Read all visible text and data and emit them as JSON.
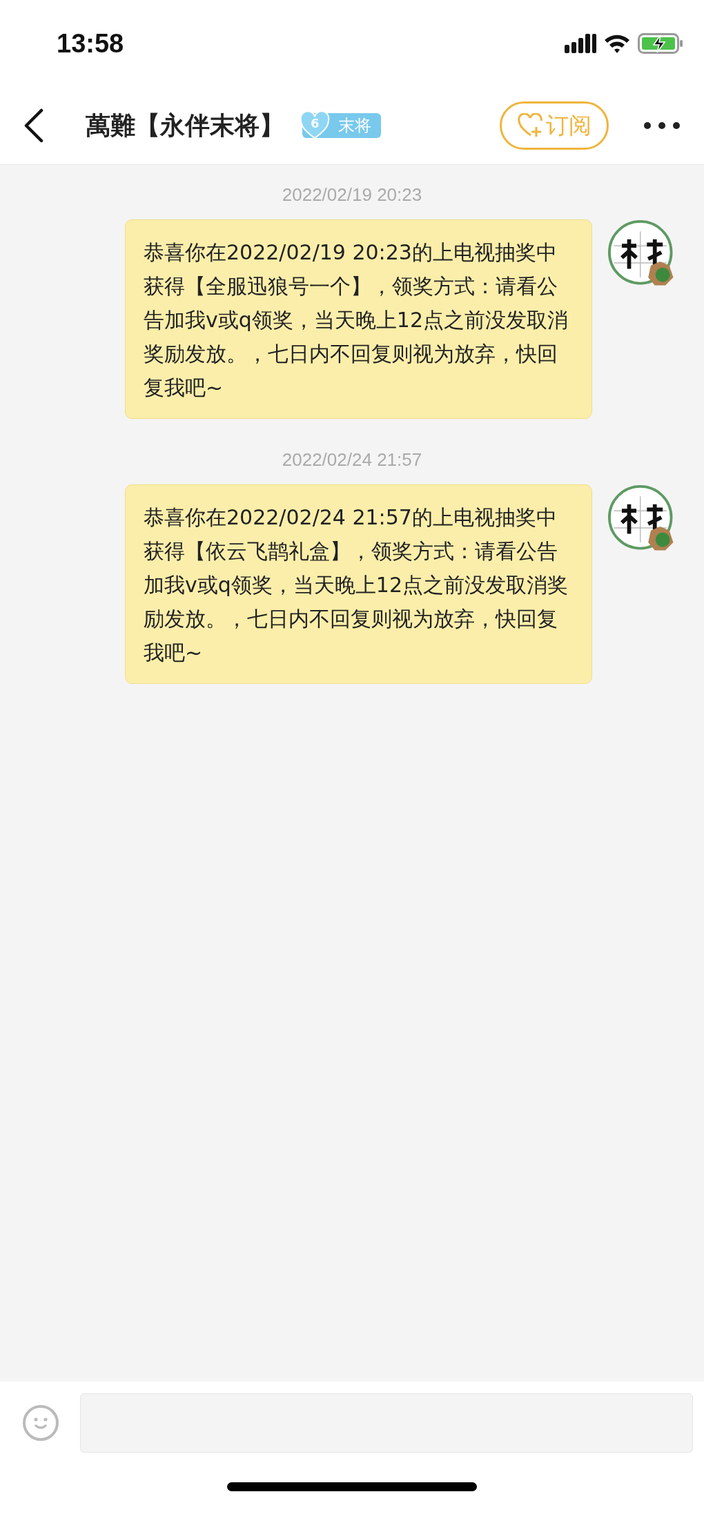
{
  "status_bar": {
    "time": "13:58"
  },
  "header": {
    "title": "萬難【永伴末将】",
    "fan_badge": {
      "level": "6",
      "name": "末将"
    },
    "subscribe_button": "订阅"
  },
  "messages": [
    {
      "timestamp": "2022/02/19 20:23",
      "text": "恭喜你在2022/02/19 20:23的上电视抽奖中获得【全服迅狼号一个】，领奖方式：请看公告加我v或q领奖，当天晚上12点之前没发取消奖励发放。，七日内不回复则视为放弃，快回复我吧~"
    },
    {
      "timestamp": "2022/02/24 21:57",
      "text": "恭喜你在2022/02/24 21:57的上电视抽奖中获得【依云飞鹊礼盒】，领奖方式：请看公告加我v或q领奖，当天晚上12点之前没发取消奖励发放。，七日内不回复则视为放弃，快回复我吧~"
    }
  ]
}
